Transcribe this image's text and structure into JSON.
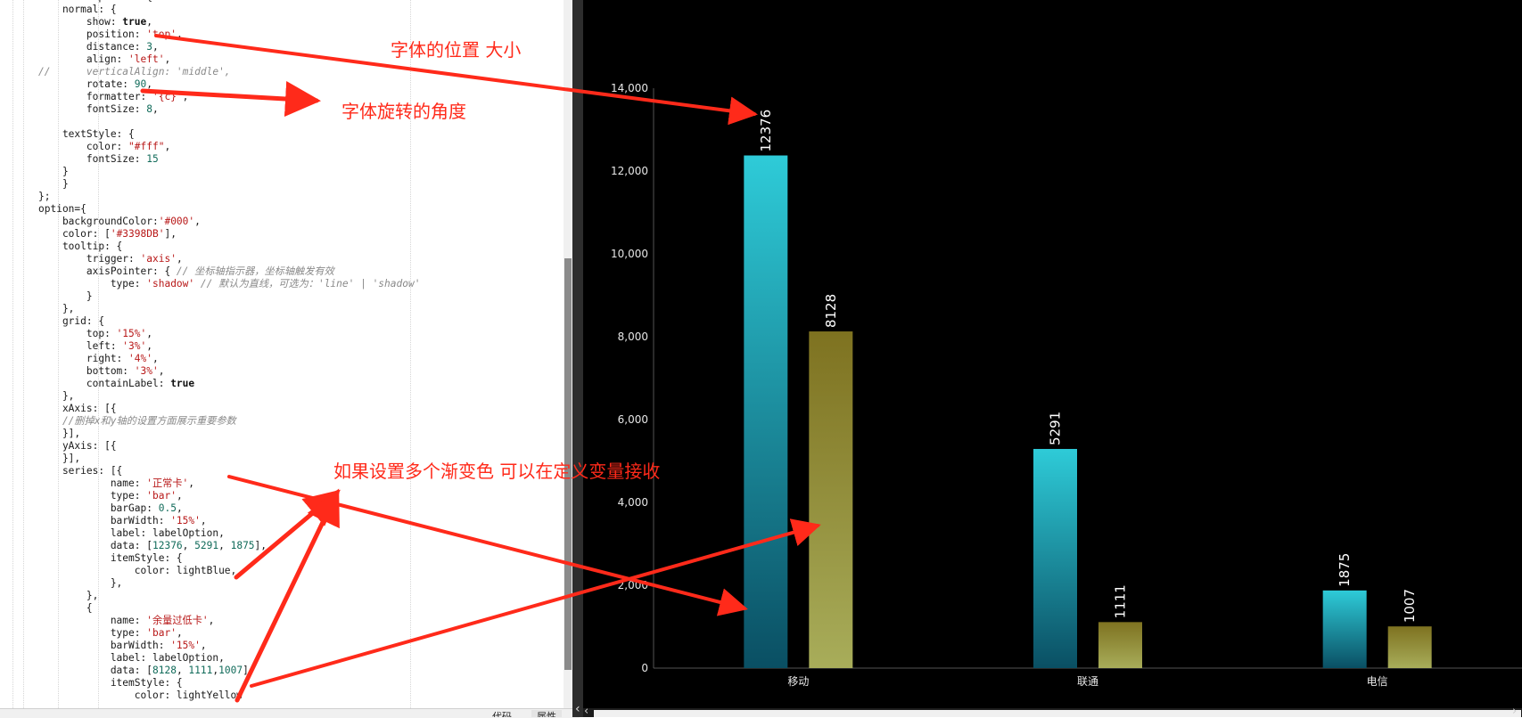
{
  "editor": {
    "lines": [
      [
        [
          "",
          "var labelOption = {"
        ]
      ],
      [
        [
          "",
          "    normal: {"
        ]
      ],
      [
        [
          "",
          "        show: "
        ],
        [
          "kw",
          "true"
        ],
        [
          "",
          ","
        ]
      ],
      [
        [
          "",
          "        position: "
        ],
        [
          "str",
          "'top'"
        ],
        [
          "",
          ","
        ]
      ],
      [
        [
          "",
          "        distance: "
        ],
        [
          "num",
          "3"
        ],
        [
          "",
          ","
        ]
      ],
      [
        [
          "",
          "        align: "
        ],
        [
          "str",
          "'left'"
        ],
        [
          "",
          ","
        ]
      ],
      [
        [
          "cm",
          "//      verticalAlign: 'middle',"
        ]
      ],
      [
        [
          "",
          "        rotate: "
        ],
        [
          "num",
          "90"
        ],
        [
          "",
          ","
        ]
      ],
      [
        [
          "",
          "        formatter: "
        ],
        [
          "str",
          "'{c}'"
        ],
        [
          "",
          ","
        ]
      ],
      [
        [
          "",
          "        fontSize: "
        ],
        [
          "num",
          "8"
        ],
        [
          "",
          ","
        ]
      ],
      [
        [
          "",
          ""
        ]
      ],
      [
        [
          "",
          "    textStyle: {"
        ]
      ],
      [
        [
          "",
          "        color: "
        ],
        [
          "str",
          "\"#fff\""
        ],
        [
          "",
          ","
        ]
      ],
      [
        [
          "",
          "        fontSize: "
        ],
        [
          "num",
          "15"
        ]
      ],
      [
        [
          "",
          "    }"
        ]
      ],
      [
        [
          "",
          "    }"
        ]
      ],
      [
        [
          "",
          "};"
        ]
      ],
      [
        [
          "",
          "option={"
        ]
      ],
      [
        [
          "",
          "    backgroundColor:"
        ],
        [
          "str",
          "'#000'"
        ],
        [
          "",
          ","
        ]
      ],
      [
        [
          "",
          "    color: ["
        ],
        [
          "str",
          "'#3398DB'"
        ],
        [
          "",
          "],"
        ]
      ],
      [
        [
          "",
          "    tooltip: {"
        ]
      ],
      [
        [
          "",
          "        trigger: "
        ],
        [
          "str",
          "'axis'"
        ],
        [
          "",
          ","
        ]
      ],
      [
        [
          "",
          "        axisPointer: { "
        ],
        [
          "cm",
          "// 坐标轴指示器，坐标轴触发有效"
        ]
      ],
      [
        [
          "",
          "            type: "
        ],
        [
          "str",
          "'shadow'"
        ],
        [
          "cm",
          " // 默认为直线，可选为：'line' | 'shadow'"
        ]
      ],
      [
        [
          "",
          "        }"
        ]
      ],
      [
        [
          "",
          "    },"
        ]
      ],
      [
        [
          "",
          "    grid: {"
        ]
      ],
      [
        [
          "",
          "        top: "
        ],
        [
          "str",
          "'15%'"
        ],
        [
          "",
          ","
        ]
      ],
      [
        [
          "",
          "        left: "
        ],
        [
          "str",
          "'3%'"
        ],
        [
          "",
          ","
        ]
      ],
      [
        [
          "",
          "        right: "
        ],
        [
          "str",
          "'4%'"
        ],
        [
          "",
          ","
        ]
      ],
      [
        [
          "",
          "        bottom: "
        ],
        [
          "str",
          "'3%'"
        ],
        [
          "",
          ","
        ]
      ],
      [
        [
          "",
          "        containLabel: "
        ],
        [
          "kw",
          "true"
        ]
      ],
      [
        [
          "",
          "    },"
        ]
      ],
      [
        [
          "",
          "    xAxis: [{"
        ]
      ],
      [
        [
          "cm",
          "    //删掉x和y轴的设置方面展示重要参数"
        ]
      ],
      [
        [
          "",
          "    }],"
        ]
      ],
      [
        [
          "",
          "    yAxis: [{"
        ]
      ],
      [
        [
          "",
          "    }],"
        ]
      ],
      [
        [
          "",
          "    series: [{"
        ]
      ],
      [
        [
          "",
          "            name: "
        ],
        [
          "str",
          "'正常卡'"
        ],
        [
          "",
          ","
        ]
      ],
      [
        [
          "",
          "            type: "
        ],
        [
          "str",
          "'bar'"
        ],
        [
          "",
          ","
        ]
      ],
      [
        [
          "",
          "            barGap: "
        ],
        [
          "num",
          "0.5"
        ],
        [
          "",
          ","
        ]
      ],
      [
        [
          "",
          "            barWidth: "
        ],
        [
          "str",
          "'15%'"
        ],
        [
          "",
          ","
        ]
      ],
      [
        [
          "",
          "            label: labelOption,"
        ]
      ],
      [
        [
          "",
          "            data: ["
        ],
        [
          "num",
          "12376"
        ],
        [
          "",
          ", "
        ],
        [
          "num",
          "5291"
        ],
        [
          "",
          ", "
        ],
        [
          "num",
          "1875"
        ],
        [
          "",
          "],"
        ]
      ],
      [
        [
          "",
          "            itemStyle: {"
        ]
      ],
      [
        [
          "",
          "                color: lightBlue,"
        ]
      ],
      [
        [
          "",
          "            },"
        ]
      ],
      [
        [
          "",
          "        },"
        ]
      ],
      [
        [
          "",
          "        {"
        ]
      ],
      [
        [
          "",
          "            name: "
        ],
        [
          "str",
          "'余量过低卡'"
        ],
        [
          "",
          ","
        ]
      ],
      [
        [
          "",
          "            type: "
        ],
        [
          "str",
          "'bar'"
        ],
        [
          "",
          ","
        ]
      ],
      [
        [
          "",
          "            barWidth: "
        ],
        [
          "str",
          "'15%'"
        ],
        [
          "",
          ","
        ]
      ],
      [
        [
          "",
          "            label: labelOption,"
        ]
      ],
      [
        [
          "",
          "            data: ["
        ],
        [
          "num",
          "8128"
        ],
        [
          "",
          ", "
        ],
        [
          "num",
          "1111"
        ],
        [
          "",
          ","
        ],
        [
          "num",
          "1007"
        ],
        [
          "",
          "],"
        ]
      ],
      [
        [
          "",
          "            itemStyle: {"
        ]
      ],
      [
        [
          "",
          "                color: lightYellow"
        ]
      ]
    ],
    "tabs": [
      "代码",
      "属性"
    ]
  },
  "annotations": {
    "position_note": "字体的位置 大小",
    "rotate_note": "字体旋转的角度",
    "gradient_note": "如果设置多个渐变色 可以在定义变量接收"
  },
  "colors": {
    "annotation": "#ff2a1a",
    "bar_blue_top": "#2ecbd8",
    "bar_blue_bottom": "#0a4f63",
    "bar_yellow_top": "#7e7220",
    "bar_yellow_bottom": "#a8ad5a",
    "chart_bg": "#000000"
  },
  "chart_data": {
    "type": "bar",
    "categories": [
      "移动",
      "联通",
      "电信"
    ],
    "series": [
      {
        "values": [
          12376,
          5291,
          1875
        ]
      },
      {
        "values": [
          8128,
          1111,
          1007
        ]
      }
    ],
    "yticks": [
      "0",
      "2,000",
      "4,000",
      "6,000",
      "8,000",
      "10,000",
      "12,000",
      "14,000"
    ],
    "ylim": [
      0,
      14000
    ],
    "grid": false,
    "label_rotation": "vertical"
  }
}
